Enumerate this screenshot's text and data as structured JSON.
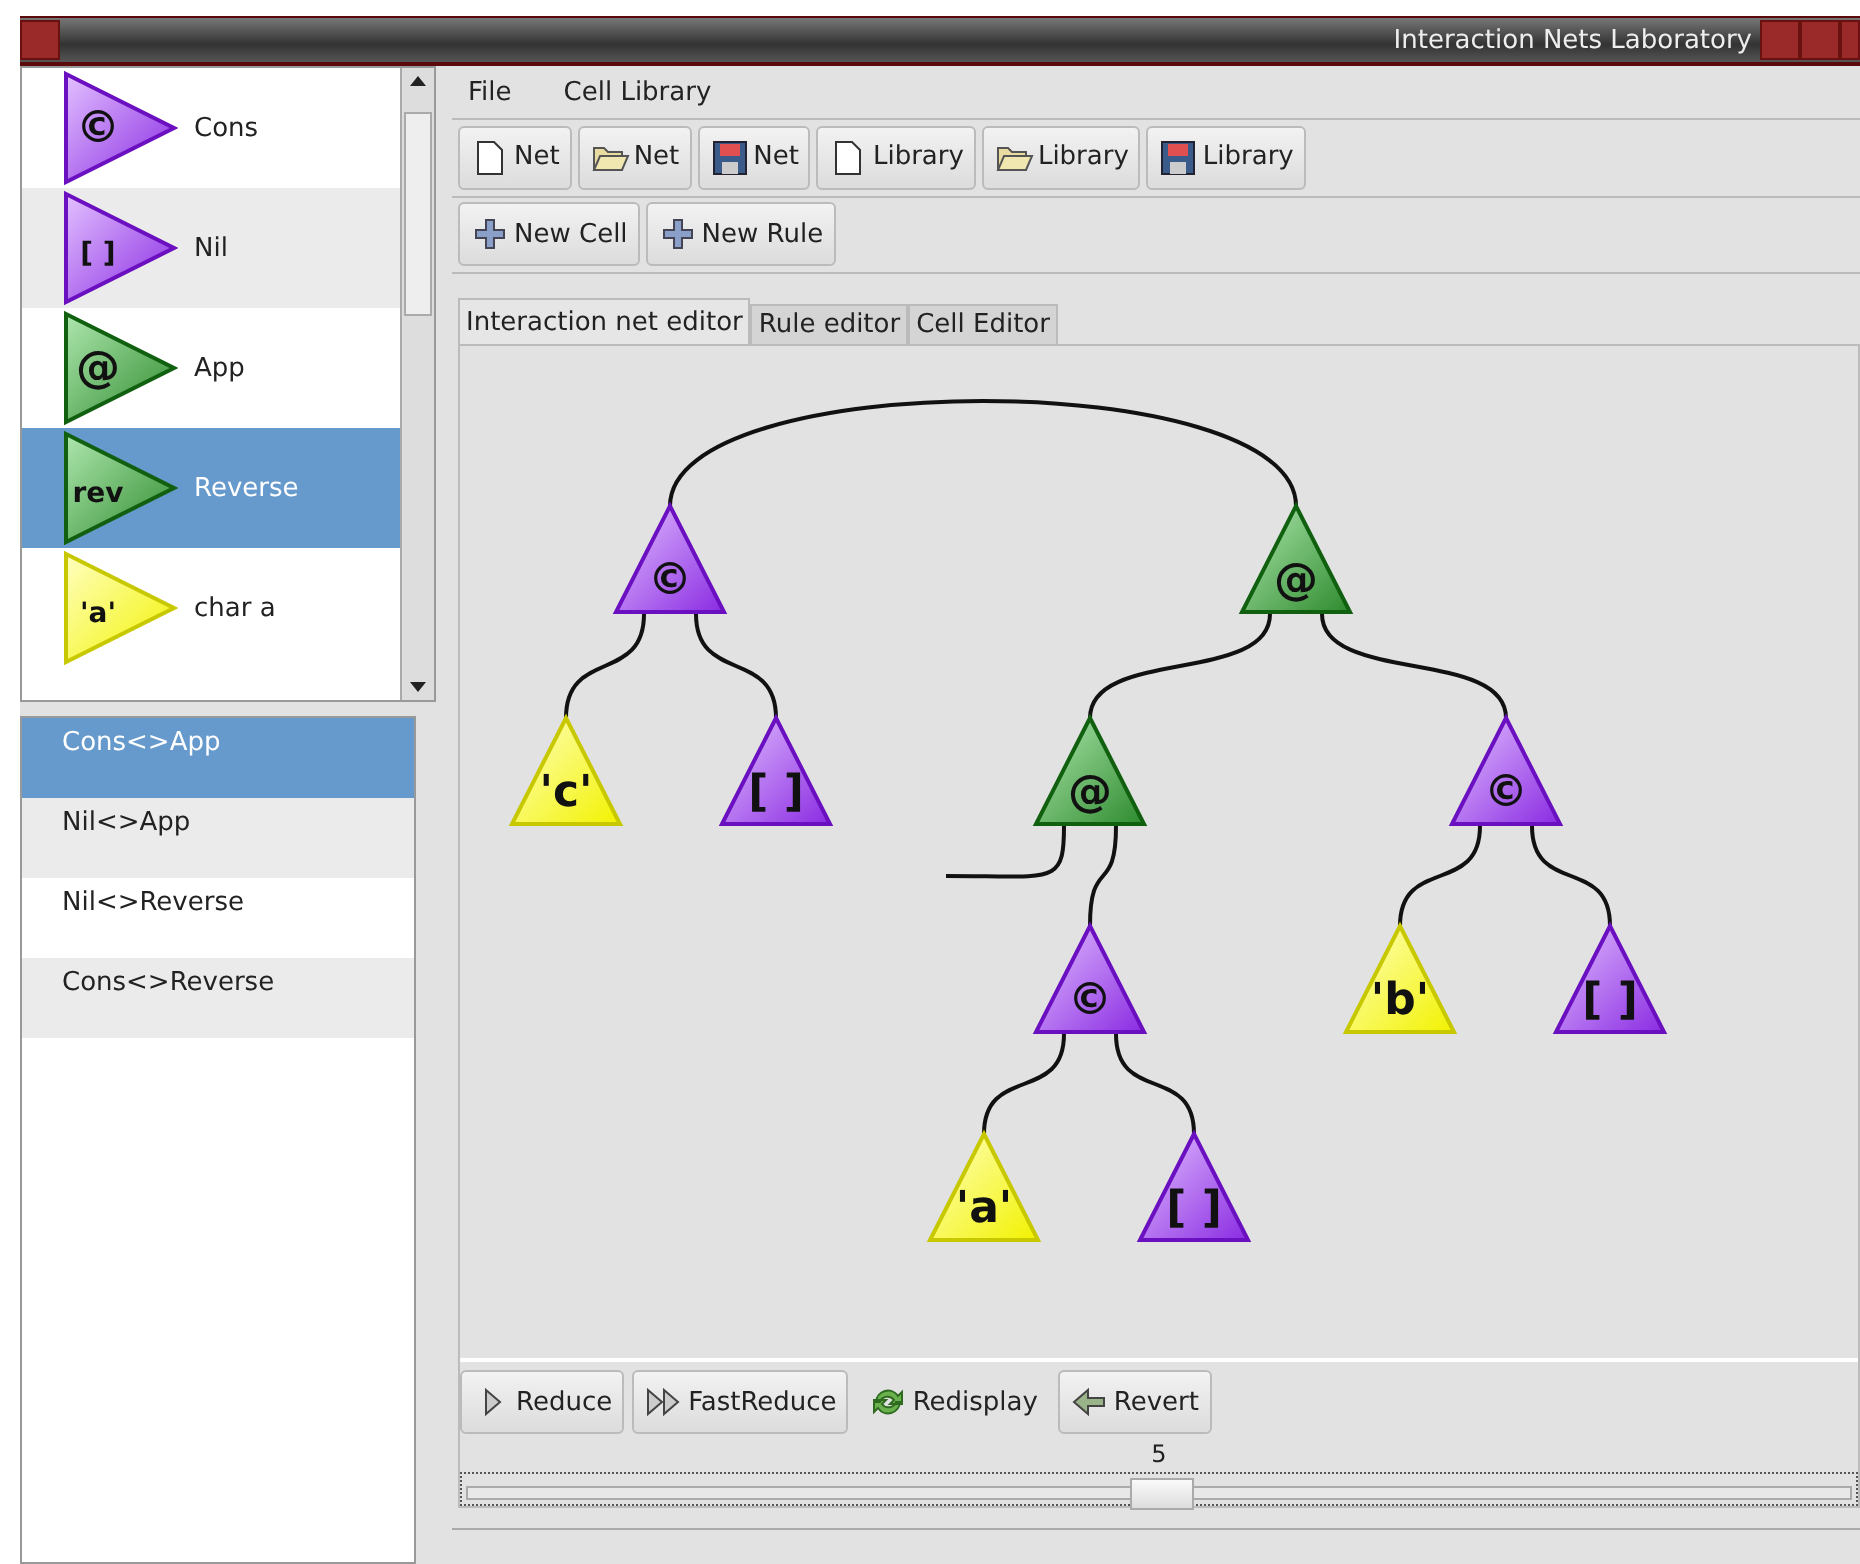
{
  "window": {
    "title": "Interaction Nets Laboratory"
  },
  "cells": [
    {
      "kind": "purple",
      "symbol": "©",
      "label": "Cons",
      "selected": false
    },
    {
      "kind": "purple",
      "symbol": "[ ]",
      "label": "Nil",
      "selected": false
    },
    {
      "kind": "green",
      "symbol": "@",
      "label": "App",
      "selected": false
    },
    {
      "kind": "green",
      "symbol": "rev",
      "label": "Reverse",
      "selected": true
    },
    {
      "kind": "yellow",
      "symbol": "'a'",
      "label": "char a",
      "selected": false
    }
  ],
  "rules": [
    {
      "label": "Cons<>App",
      "selected": true
    },
    {
      "label": "Nil<>App",
      "selected": false
    },
    {
      "label": "Nil<>Reverse",
      "selected": false
    },
    {
      "label": "Cons<>Reverse",
      "selected": false
    }
  ],
  "menu": [
    {
      "label": "File"
    },
    {
      "label": "Cell Library"
    }
  ],
  "toolbar": [
    {
      "kind": "new",
      "label": "Net"
    },
    {
      "kind": "open",
      "label": "Net"
    },
    {
      "kind": "save",
      "label": "Net"
    },
    {
      "kind": "new",
      "label": "Library"
    },
    {
      "kind": "open",
      "label": "Library"
    },
    {
      "kind": "save",
      "label": "Library"
    }
  ],
  "toolbar2": [
    {
      "kind": "plus",
      "label": "New Cell"
    },
    {
      "kind": "plus",
      "label": "New Rule"
    }
  ],
  "tabs": [
    {
      "label": "Interaction net editor",
      "selected": true
    },
    {
      "label": "Rule editor",
      "selected": false
    },
    {
      "label": "Cell Editor",
      "selected": false
    }
  ],
  "net": [
    {
      "kind": "purple",
      "symbol": "©",
      "children": [
        {
          "kind": "yellow",
          "symbol": "'c'"
        },
        {
          "kind": "purple",
          "symbol": "[ ]"
        }
      ]
    },
    {
      "kind": "green",
      "symbol": "@",
      "children": [
        {
          "kind": "green",
          "symbol": "@",
          "children": [
            {
              "kind": "wire"
            },
            {
              "kind": "purple",
              "symbol": "©",
              "children": [
                {
                  "kind": "yellow",
                  "symbol": "'a'"
                },
                {
                  "kind": "purple",
                  "symbol": "[ ]"
                }
              ]
            }
          ]
        },
        {
          "kind": "purple",
          "symbol": "©",
          "children": [
            {
              "kind": "yellow",
              "symbol": "'b'"
            },
            {
              "kind": "purple",
              "symbol": "[ ]"
            }
          ]
        }
      ]
    }
  ],
  "actions": [
    {
      "kind": "play",
      "label": "Reduce",
      "flat": false
    },
    {
      "kind": "fast",
      "label": "FastReduce",
      "flat": false
    },
    {
      "kind": "refresh",
      "label": "Redisplay",
      "flat": true
    },
    {
      "kind": "back",
      "label": "Revert",
      "flat": false
    }
  ],
  "slider": {
    "value": "5",
    "level": 0.5
  }
}
